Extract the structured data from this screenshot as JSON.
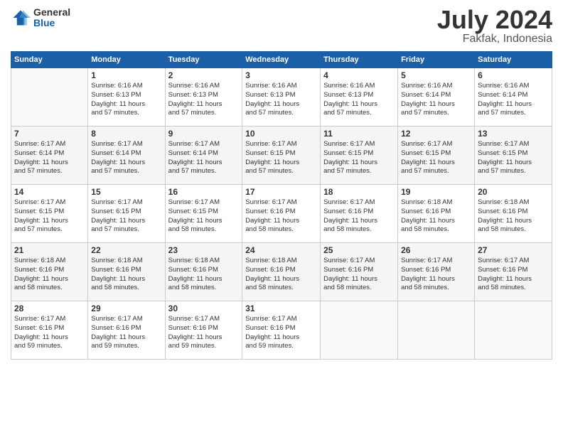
{
  "header": {
    "logo_general": "General",
    "logo_blue": "Blue",
    "title": "July 2024",
    "location": "Fakfak, Indonesia"
  },
  "days_of_week": [
    "Sunday",
    "Monday",
    "Tuesday",
    "Wednesday",
    "Thursday",
    "Friday",
    "Saturday"
  ],
  "weeks": [
    [
      {
        "day": "",
        "empty": true
      },
      {
        "day": "1",
        "sunrise": "6:16 AM",
        "sunset": "6:13 PM",
        "daylight": "11 hours and 57 minutes."
      },
      {
        "day": "2",
        "sunrise": "6:16 AM",
        "sunset": "6:13 PM",
        "daylight": "11 hours and 57 minutes."
      },
      {
        "day": "3",
        "sunrise": "6:16 AM",
        "sunset": "6:13 PM",
        "daylight": "11 hours and 57 minutes."
      },
      {
        "day": "4",
        "sunrise": "6:16 AM",
        "sunset": "6:13 PM",
        "daylight": "11 hours and 57 minutes."
      },
      {
        "day": "5",
        "sunrise": "6:16 AM",
        "sunset": "6:14 PM",
        "daylight": "11 hours and 57 minutes."
      },
      {
        "day": "6",
        "sunrise": "6:16 AM",
        "sunset": "6:14 PM",
        "daylight": "11 hours and 57 minutes."
      }
    ],
    [
      {
        "day": "7",
        "sunrise": "6:17 AM",
        "sunset": "6:14 PM",
        "daylight": "11 hours and 57 minutes."
      },
      {
        "day": "8",
        "sunrise": "6:17 AM",
        "sunset": "6:14 PM",
        "daylight": "11 hours and 57 minutes."
      },
      {
        "day": "9",
        "sunrise": "6:17 AM",
        "sunset": "6:14 PM",
        "daylight": "11 hours and 57 minutes."
      },
      {
        "day": "10",
        "sunrise": "6:17 AM",
        "sunset": "6:15 PM",
        "daylight": "11 hours and 57 minutes."
      },
      {
        "day": "11",
        "sunrise": "6:17 AM",
        "sunset": "6:15 PM",
        "daylight": "11 hours and 57 minutes."
      },
      {
        "day": "12",
        "sunrise": "6:17 AM",
        "sunset": "6:15 PM",
        "daylight": "11 hours and 57 minutes."
      },
      {
        "day": "13",
        "sunrise": "6:17 AM",
        "sunset": "6:15 PM",
        "daylight": "11 hours and 57 minutes."
      }
    ],
    [
      {
        "day": "14",
        "sunrise": "6:17 AM",
        "sunset": "6:15 PM",
        "daylight": "11 hours and 57 minutes."
      },
      {
        "day": "15",
        "sunrise": "6:17 AM",
        "sunset": "6:15 PM",
        "daylight": "11 hours and 57 minutes."
      },
      {
        "day": "16",
        "sunrise": "6:17 AM",
        "sunset": "6:15 PM",
        "daylight": "11 hours and 58 minutes."
      },
      {
        "day": "17",
        "sunrise": "6:17 AM",
        "sunset": "6:16 PM",
        "daylight": "11 hours and 58 minutes."
      },
      {
        "day": "18",
        "sunrise": "6:17 AM",
        "sunset": "6:16 PM",
        "daylight": "11 hours and 58 minutes."
      },
      {
        "day": "19",
        "sunrise": "6:18 AM",
        "sunset": "6:16 PM",
        "daylight": "11 hours and 58 minutes."
      },
      {
        "day": "20",
        "sunrise": "6:18 AM",
        "sunset": "6:16 PM",
        "daylight": "11 hours and 58 minutes."
      }
    ],
    [
      {
        "day": "21",
        "sunrise": "6:18 AM",
        "sunset": "6:16 PM",
        "daylight": "11 hours and 58 minutes."
      },
      {
        "day": "22",
        "sunrise": "6:18 AM",
        "sunset": "6:16 PM",
        "daylight": "11 hours and 58 minutes."
      },
      {
        "day": "23",
        "sunrise": "6:18 AM",
        "sunset": "6:16 PM",
        "daylight": "11 hours and 58 minutes."
      },
      {
        "day": "24",
        "sunrise": "6:18 AM",
        "sunset": "6:16 PM",
        "daylight": "11 hours and 58 minutes."
      },
      {
        "day": "25",
        "sunrise": "6:17 AM",
        "sunset": "6:16 PM",
        "daylight": "11 hours and 58 minutes."
      },
      {
        "day": "26",
        "sunrise": "6:17 AM",
        "sunset": "6:16 PM",
        "daylight": "11 hours and 58 minutes."
      },
      {
        "day": "27",
        "sunrise": "6:17 AM",
        "sunset": "6:16 PM",
        "daylight": "11 hours and 58 minutes."
      }
    ],
    [
      {
        "day": "28",
        "sunrise": "6:17 AM",
        "sunset": "6:16 PM",
        "daylight": "11 hours and 59 minutes."
      },
      {
        "day": "29",
        "sunrise": "6:17 AM",
        "sunset": "6:16 PM",
        "daylight": "11 hours and 59 minutes."
      },
      {
        "day": "30",
        "sunrise": "6:17 AM",
        "sunset": "6:16 PM",
        "daylight": "11 hours and 59 minutes."
      },
      {
        "day": "31",
        "sunrise": "6:17 AM",
        "sunset": "6:16 PM",
        "daylight": "11 hours and 59 minutes."
      },
      {
        "day": "",
        "empty": true
      },
      {
        "day": "",
        "empty": true
      },
      {
        "day": "",
        "empty": true
      }
    ]
  ],
  "labels": {
    "sunrise": "Sunrise:",
    "sunset": "Sunset:",
    "daylight": "Daylight:"
  }
}
